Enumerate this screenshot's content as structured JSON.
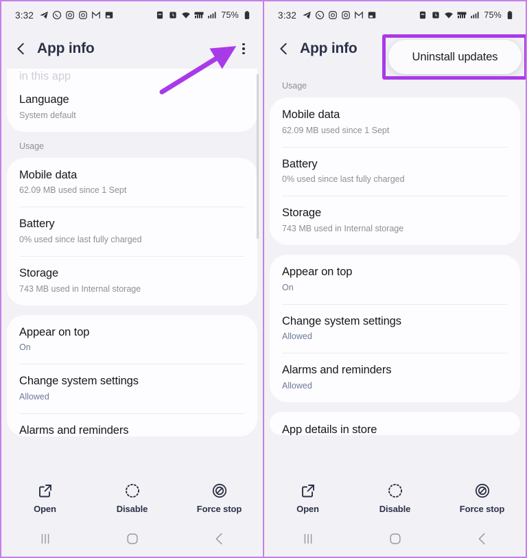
{
  "status_bar": {
    "time": "3:32",
    "left_icons": [
      "telegram-icon",
      "whatsapp-icon",
      "instagram-icon",
      "instagram-icon",
      "gmail-icon",
      "screenshot-icon"
    ],
    "right_icons": [
      "dnd-icon",
      "alarm-icon",
      "wifi-icon",
      "lte-icon",
      "signal-icon"
    ],
    "battery_percent": "75%"
  },
  "app_bar": {
    "title": "App info",
    "back_icon": "chevron-left-icon",
    "more_icon": "kebab-menu-icon"
  },
  "left_panel": {
    "ghost_top_text": "in this app",
    "sections": [
      {
        "label": "",
        "rows": [
          {
            "title": "Language",
            "sub": "System default",
            "sub_style": "muted"
          }
        ]
      },
      {
        "label": "Usage",
        "rows": [
          {
            "title": "Mobile data",
            "sub": "62.09 MB used since 1 Sept",
            "sub_style": "muted"
          },
          {
            "title": "Battery",
            "sub": "0% used since last fully charged",
            "sub_style": "muted"
          },
          {
            "title": "Storage",
            "sub": "743 MB used in Internal storage",
            "sub_style": "muted"
          }
        ]
      },
      {
        "label": "",
        "rows": [
          {
            "title": "Appear on top",
            "sub": "On",
            "sub_style": "blue"
          },
          {
            "title": "Change system settings",
            "sub": "Allowed",
            "sub_style": "blue"
          },
          {
            "title": "Alarms and reminders",
            "sub": "",
            "sub_style": "blue"
          }
        ]
      }
    ]
  },
  "right_panel": {
    "popup_label": "Uninstall updates",
    "sections": [
      {
        "label": "Usage",
        "rows": [
          {
            "title": "Mobile data",
            "sub": "62.09 MB used since 1 Sept",
            "sub_style": "muted"
          },
          {
            "title": "Battery",
            "sub": "0% used since last fully charged",
            "sub_style": "muted"
          },
          {
            "title": "Storage",
            "sub": "743 MB used in Internal storage",
            "sub_style": "muted"
          }
        ]
      },
      {
        "label": "",
        "rows": [
          {
            "title": "Appear on top",
            "sub": "On",
            "sub_style": "blue"
          },
          {
            "title": "Change system settings",
            "sub": "Allowed",
            "sub_style": "blue"
          },
          {
            "title": "Alarms and reminders",
            "sub": "Allowed",
            "sub_style": "blue"
          }
        ]
      },
      {
        "label": "",
        "rows": [
          {
            "title": "App details in store",
            "sub": "",
            "sub_style": "muted"
          }
        ]
      }
    ]
  },
  "action_bar": {
    "actions": [
      {
        "label": "Open",
        "icon": "external-link-icon"
      },
      {
        "label": "Disable",
        "icon": "dashed-circle-icon"
      },
      {
        "label": "Force stop",
        "icon": "block-circle-icon"
      }
    ]
  },
  "nav_bar": {
    "buttons": [
      {
        "name": "recents-button",
        "icon": "recents-icon"
      },
      {
        "name": "home-button",
        "icon": "home-icon"
      },
      {
        "name": "back-button",
        "icon": "back-icon"
      }
    ]
  },
  "annotations": {
    "accent_color": "#a93ae8",
    "arrow_target": "kebab-menu-icon",
    "highlight_target": "uninstall-updates-menu-item"
  }
}
